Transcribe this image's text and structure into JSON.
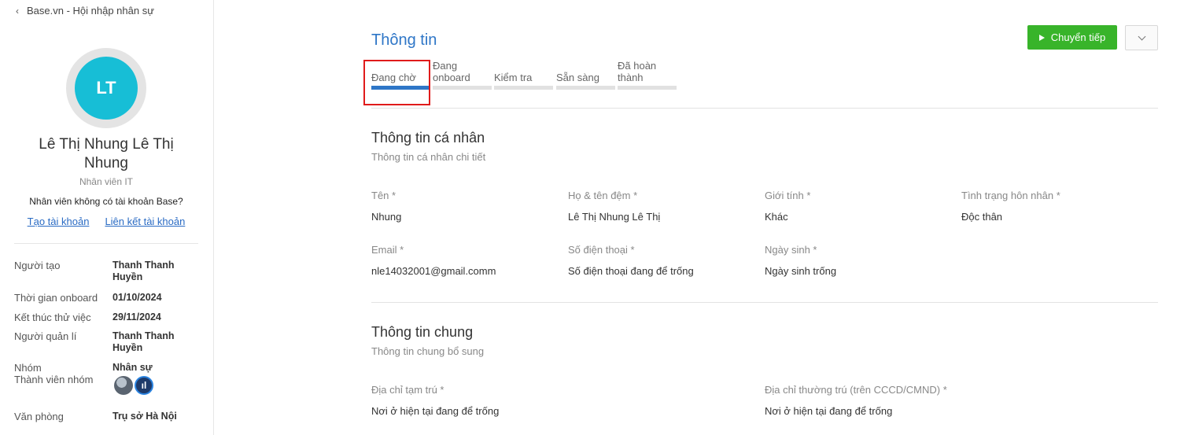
{
  "sidebar": {
    "back_label": "Base.vn - Hội nhập nhân sự",
    "avatar_initials": "LT",
    "name": "Lê Thị Nhung Lê Thị Nhung",
    "role": "Nhân viên IT",
    "no_account_text": "Nhân viên không có tài khoản Base?",
    "create_account": "Tạo tài khoản",
    "link_account": "Liên kết tài khoản",
    "info": [
      {
        "key": "Người tạo",
        "value": "Thanh Thanh Huyền"
      },
      {
        "key": "Thời gian onboard",
        "value": "01/10/2024"
      },
      {
        "key": "Kết thúc thử việc",
        "value": "29/11/2024"
      },
      {
        "key": "Người quản lí",
        "value": "Thanh Thanh Huyền"
      },
      {
        "key": "Nhóm",
        "value": "Nhân sự"
      },
      {
        "key": "Thành viên nhóm",
        "value": ""
      },
      {
        "key": "Văn phòng",
        "value": "Trụ sở Hà Nội"
      }
    ]
  },
  "main": {
    "title": "Thông tin",
    "next_button": "Chuyển tiếp",
    "steps": [
      {
        "label": "Đang chờ",
        "active": true
      },
      {
        "label": "Đang onboard",
        "active": false
      },
      {
        "label": "Kiểm tra",
        "active": false
      },
      {
        "label": "Sẵn sàng",
        "active": false
      },
      {
        "label": "Đã hoàn thành",
        "active": false
      }
    ],
    "personal": {
      "title": "Thông tin cá nhân",
      "subtitle": "Thông tin cá nhân chi tiết",
      "fields": [
        {
          "label": "Tên *",
          "value": "Nhung"
        },
        {
          "label": "Họ & tên đệm *",
          "value": "Lê Thị Nhung Lê Thị"
        },
        {
          "label": "Giới tính *",
          "value": "Khác"
        },
        {
          "label": "Tình trạng hôn nhân *",
          "value": "Độc thân"
        },
        {
          "label": "Email *",
          "value": "nle14032001@gmail.comm"
        },
        {
          "label": "Số điện thoại *",
          "value": "Số điện thoại đang để trống"
        },
        {
          "label": "Ngày sinh *",
          "value": "Ngày sinh trống"
        }
      ]
    },
    "general": {
      "title": "Thông tin chung",
      "subtitle": "Thông tin chung bổ sung",
      "fields": [
        {
          "label": "Địa chỉ tạm trú *",
          "value": "Nơi ở hiện tại đang để trống"
        },
        {
          "label": "Địa chỉ thường trú (trên CCCD/CMND) *",
          "value": "Nơi ở hiện tại đang để trống"
        }
      ]
    }
  },
  "colors": {
    "accent": "#2e76c7",
    "avatar": "#17bed6",
    "next_button": "#38b42a",
    "highlight": "#e01b1b"
  }
}
